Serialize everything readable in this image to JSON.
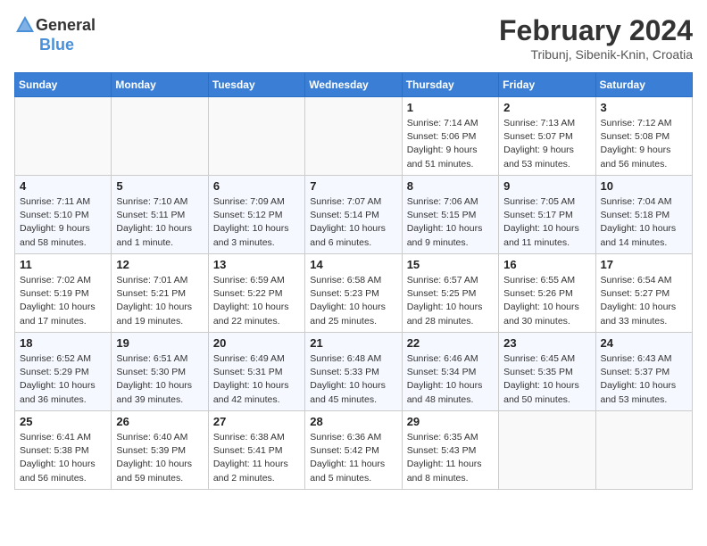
{
  "header": {
    "logo_general": "General",
    "logo_blue": "Blue",
    "month_year": "February 2024",
    "location": "Tribunj, Sibenik-Knin, Croatia"
  },
  "weekdays": [
    "Sunday",
    "Monday",
    "Tuesday",
    "Wednesday",
    "Thursday",
    "Friday",
    "Saturday"
  ],
  "weeks": [
    [
      {
        "day": "",
        "info": ""
      },
      {
        "day": "",
        "info": ""
      },
      {
        "day": "",
        "info": ""
      },
      {
        "day": "",
        "info": ""
      },
      {
        "day": "1",
        "info": "Sunrise: 7:14 AM\nSunset: 5:06 PM\nDaylight: 9 hours\nand 51 minutes."
      },
      {
        "day": "2",
        "info": "Sunrise: 7:13 AM\nSunset: 5:07 PM\nDaylight: 9 hours\nand 53 minutes."
      },
      {
        "day": "3",
        "info": "Sunrise: 7:12 AM\nSunset: 5:08 PM\nDaylight: 9 hours\nand 56 minutes."
      }
    ],
    [
      {
        "day": "4",
        "info": "Sunrise: 7:11 AM\nSunset: 5:10 PM\nDaylight: 9 hours\nand 58 minutes."
      },
      {
        "day": "5",
        "info": "Sunrise: 7:10 AM\nSunset: 5:11 PM\nDaylight: 10 hours\nand 1 minute."
      },
      {
        "day": "6",
        "info": "Sunrise: 7:09 AM\nSunset: 5:12 PM\nDaylight: 10 hours\nand 3 minutes."
      },
      {
        "day": "7",
        "info": "Sunrise: 7:07 AM\nSunset: 5:14 PM\nDaylight: 10 hours\nand 6 minutes."
      },
      {
        "day": "8",
        "info": "Sunrise: 7:06 AM\nSunset: 5:15 PM\nDaylight: 10 hours\nand 9 minutes."
      },
      {
        "day": "9",
        "info": "Sunrise: 7:05 AM\nSunset: 5:17 PM\nDaylight: 10 hours\nand 11 minutes."
      },
      {
        "day": "10",
        "info": "Sunrise: 7:04 AM\nSunset: 5:18 PM\nDaylight: 10 hours\nand 14 minutes."
      }
    ],
    [
      {
        "day": "11",
        "info": "Sunrise: 7:02 AM\nSunset: 5:19 PM\nDaylight: 10 hours\nand 17 minutes."
      },
      {
        "day": "12",
        "info": "Sunrise: 7:01 AM\nSunset: 5:21 PM\nDaylight: 10 hours\nand 19 minutes."
      },
      {
        "day": "13",
        "info": "Sunrise: 6:59 AM\nSunset: 5:22 PM\nDaylight: 10 hours\nand 22 minutes."
      },
      {
        "day": "14",
        "info": "Sunrise: 6:58 AM\nSunset: 5:23 PM\nDaylight: 10 hours\nand 25 minutes."
      },
      {
        "day": "15",
        "info": "Sunrise: 6:57 AM\nSunset: 5:25 PM\nDaylight: 10 hours\nand 28 minutes."
      },
      {
        "day": "16",
        "info": "Sunrise: 6:55 AM\nSunset: 5:26 PM\nDaylight: 10 hours\nand 30 minutes."
      },
      {
        "day": "17",
        "info": "Sunrise: 6:54 AM\nSunset: 5:27 PM\nDaylight: 10 hours\nand 33 minutes."
      }
    ],
    [
      {
        "day": "18",
        "info": "Sunrise: 6:52 AM\nSunset: 5:29 PM\nDaylight: 10 hours\nand 36 minutes."
      },
      {
        "day": "19",
        "info": "Sunrise: 6:51 AM\nSunset: 5:30 PM\nDaylight: 10 hours\nand 39 minutes."
      },
      {
        "day": "20",
        "info": "Sunrise: 6:49 AM\nSunset: 5:31 PM\nDaylight: 10 hours\nand 42 minutes."
      },
      {
        "day": "21",
        "info": "Sunrise: 6:48 AM\nSunset: 5:33 PM\nDaylight: 10 hours\nand 45 minutes."
      },
      {
        "day": "22",
        "info": "Sunrise: 6:46 AM\nSunset: 5:34 PM\nDaylight: 10 hours\nand 48 minutes."
      },
      {
        "day": "23",
        "info": "Sunrise: 6:45 AM\nSunset: 5:35 PM\nDaylight: 10 hours\nand 50 minutes."
      },
      {
        "day": "24",
        "info": "Sunrise: 6:43 AM\nSunset: 5:37 PM\nDaylight: 10 hours\nand 53 minutes."
      }
    ],
    [
      {
        "day": "25",
        "info": "Sunrise: 6:41 AM\nSunset: 5:38 PM\nDaylight: 10 hours\nand 56 minutes."
      },
      {
        "day": "26",
        "info": "Sunrise: 6:40 AM\nSunset: 5:39 PM\nDaylight: 10 hours\nand 59 minutes."
      },
      {
        "day": "27",
        "info": "Sunrise: 6:38 AM\nSunset: 5:41 PM\nDaylight: 11 hours\nand 2 minutes."
      },
      {
        "day": "28",
        "info": "Sunrise: 6:36 AM\nSunset: 5:42 PM\nDaylight: 11 hours\nand 5 minutes."
      },
      {
        "day": "29",
        "info": "Sunrise: 6:35 AM\nSunset: 5:43 PM\nDaylight: 11 hours\nand 8 minutes."
      },
      {
        "day": "",
        "info": ""
      },
      {
        "day": "",
        "info": ""
      }
    ]
  ]
}
